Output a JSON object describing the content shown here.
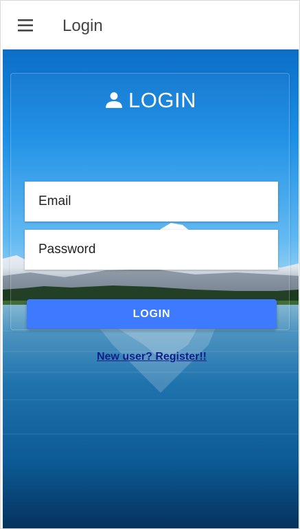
{
  "appbar": {
    "title": "Login",
    "menu_icon": "hamburger-menu-icon"
  },
  "login_card": {
    "heading": "LOGIN",
    "heading_icon": "person-icon",
    "email_placeholder": "Email",
    "password_placeholder": "Password",
    "submit_label": "LOGIN",
    "register_link": "New user? Register!!"
  },
  "colors": {
    "button": "#3d7aff",
    "link": "#0c1f8c",
    "appbar_text": "#444444"
  }
}
